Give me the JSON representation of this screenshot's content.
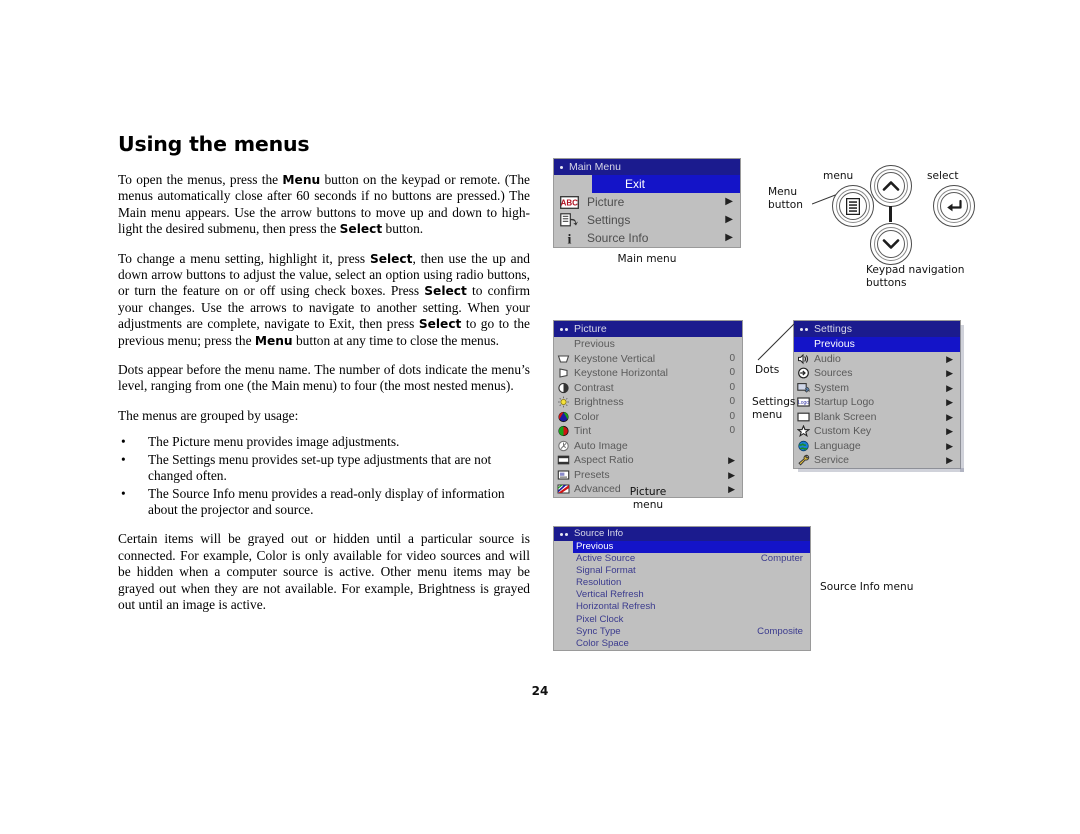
{
  "document": {
    "title": "Using the menus",
    "page_number": "24",
    "paragraphs": [
      {
        "id": "p1",
        "runs": [
          {
            "t": "To open the menus, press the "
          },
          {
            "t": "Menu",
            "b": true
          },
          {
            "t": " button on the keypad or remote. (The menus automatically close after 60 seconds if no buttons are pressed.) The Main menu appears. Use the arrow buttons to move up and down to high-light the desired submenu, then press the "
          },
          {
            "t": "Select",
            "b": true
          },
          {
            "t": " button."
          }
        ]
      },
      {
        "id": "p2",
        "runs": [
          {
            "t": "To change a menu setting, highlight it, press "
          },
          {
            "t": "Select",
            "b": true
          },
          {
            "t": ", then use the up and down arrow buttons to adjust the value, select an option using radio buttons, or turn the feature on or off using check boxes. Press "
          },
          {
            "t": "Select",
            "b": true
          },
          {
            "t": " to confirm your changes. Use the arrows to navigate to another setting. When your adjustments are complete, navigate to Exit, then press "
          },
          {
            "t": "Select",
            "b": true
          },
          {
            "t": " to go to the previous menu; press the "
          },
          {
            "t": "Menu",
            "b": true
          },
          {
            "t": " button at any time to close the menus."
          }
        ]
      },
      {
        "id": "p3",
        "runs": [
          {
            "t": "Dots appear before the menu name. The number of dots indicate the menu’s level, ranging from one (the Main menu) to four (the most nested menus)."
          }
        ]
      },
      {
        "id": "p4",
        "runs": [
          {
            "t": "The menus are grouped by usage:"
          }
        ]
      }
    ],
    "bullets": [
      "The Picture menu provides image adjustments.",
      "The Settings menu provides set-up type adjustments that are not changed often.",
      "The Source Info menu provides a read-only display of information about the projector and source."
    ],
    "bullet_glyph": "•",
    "closing_paragraph": "Certain items will be grayed out or hidden until a particular source is connected. For example, Color is only available for video sources and will be hidden when a computer source is active. Other menu items may be grayed out when they are not available. For example, Brightness is grayed out until an image is active."
  },
  "colors": {
    "title_bar": "#1b1b8e",
    "highlight_row": "#1414c8",
    "panel_body": "#c0c0c0",
    "panel_border": "#9a9a9a",
    "sourceinfo_text": "#3b3b8e",
    "menu_text": "#5a5a5a"
  },
  "main_menu": {
    "caption": "Main menu",
    "title": "Main Menu",
    "level_dots": 1,
    "rows": [
      {
        "label": "Exit",
        "icon": "",
        "arrow": false,
        "highlight": true
      },
      {
        "label": "Picture",
        "icon": "abc-icon",
        "arrow": true,
        "highlight": false
      },
      {
        "label": "Settings",
        "icon": "settings-icon",
        "arrow": true,
        "highlight": false
      },
      {
        "label": "Source Info",
        "icon": "info-icon",
        "arrow": true,
        "highlight": false
      }
    ]
  },
  "picture_menu": {
    "caption": "Picture\nmenu",
    "title": "Picture",
    "level_dots": 2,
    "rows": [
      {
        "label": "Previous",
        "icon": "",
        "value": "",
        "arrow": false,
        "highlight": false,
        "indent": true
      },
      {
        "label": "Keystone Vertical",
        "icon": "keystone-v-icon",
        "value": "0",
        "arrow": false,
        "highlight": false
      },
      {
        "label": "Keystone Horizontal",
        "icon": "keystone-h-icon",
        "value": "0",
        "arrow": false,
        "highlight": false
      },
      {
        "label": "Contrast",
        "icon": "contrast-icon",
        "value": "0",
        "arrow": false,
        "highlight": false
      },
      {
        "label": "Brightness",
        "icon": "brightness-icon",
        "value": "0",
        "arrow": false,
        "highlight": false
      },
      {
        "label": "Color",
        "icon": "color-icon",
        "value": "0",
        "arrow": false,
        "highlight": false
      },
      {
        "label": "Tint",
        "icon": "tint-icon",
        "value": "0",
        "arrow": false,
        "highlight": false
      },
      {
        "label": "Auto Image",
        "icon": "auto-image-icon",
        "value": "",
        "arrow": false,
        "highlight": false
      },
      {
        "label": "Aspect Ratio",
        "icon": "aspect-ratio-icon",
        "value": "",
        "arrow": true,
        "highlight": false
      },
      {
        "label": "Presets",
        "icon": "presets-icon",
        "value": "",
        "arrow": true,
        "highlight": false
      },
      {
        "label": "Advanced",
        "icon": "advanced-icon",
        "value": "",
        "arrow": true,
        "highlight": false
      }
    ]
  },
  "settings_menu": {
    "caption": "Settings\nmenu",
    "dots_callout": "Dots",
    "title": "Settings",
    "level_dots": 2,
    "rows": [
      {
        "label": "Previous",
        "icon": "",
        "arrow": false,
        "highlight": true
      },
      {
        "label": "Audio",
        "icon": "speaker-icon",
        "arrow": true,
        "highlight": false
      },
      {
        "label": "Sources",
        "icon": "sources-icon",
        "arrow": true,
        "highlight": false
      },
      {
        "label": "System",
        "icon": "system-icon",
        "arrow": true,
        "highlight": false
      },
      {
        "label": "Startup Logo",
        "icon": "logo-icon",
        "arrow": true,
        "highlight": false
      },
      {
        "label": "Blank Screen",
        "icon": "blank-screen-icon",
        "arrow": true,
        "highlight": false
      },
      {
        "label": "Custom Key",
        "icon": "star-icon",
        "arrow": true,
        "highlight": false
      },
      {
        "label": "Language",
        "icon": "globe-icon",
        "arrow": true,
        "highlight": false
      },
      {
        "label": "Service",
        "icon": "wrench-icon",
        "arrow": true,
        "highlight": false
      }
    ]
  },
  "sourceinfo_menu": {
    "caption": "Source Info menu",
    "title": "Source Info",
    "level_dots": 2,
    "rows": [
      {
        "label": "Previous",
        "value": "",
        "highlight": true
      },
      {
        "label": "Active Source",
        "value": "Computer",
        "highlight": false
      },
      {
        "label": "Signal Format",
        "value": "",
        "highlight": false
      },
      {
        "label": "Resolution",
        "value": "",
        "highlight": false
      },
      {
        "label": "Vertical Refresh",
        "value": "",
        "highlight": false
      },
      {
        "label": "Horizontal Refresh",
        "value": "",
        "highlight": false
      },
      {
        "label": "Pixel Clock",
        "value": "",
        "highlight": false
      },
      {
        "label": "Sync Type",
        "value": "Composite",
        "highlight": false
      },
      {
        "label": "Color Space",
        "value": "",
        "highlight": false
      }
    ]
  },
  "keypad_diagram": {
    "menu_button_label": "Menu\nbutton",
    "menu_label": "menu",
    "select_label": "select",
    "nav_caption": "Keypad navigation\nbuttons"
  }
}
